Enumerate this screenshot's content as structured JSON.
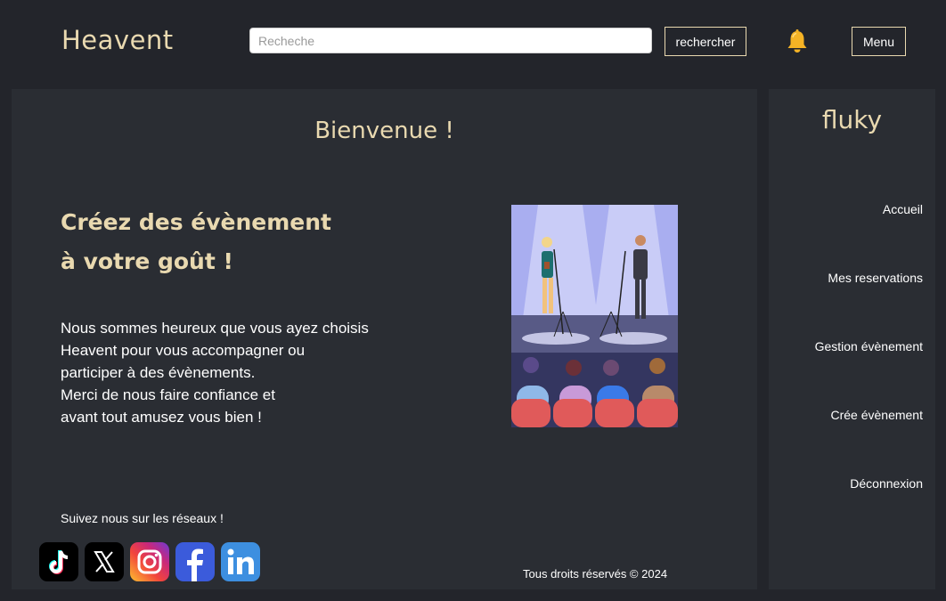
{
  "header": {
    "logo": "Heavent",
    "search": {
      "placeholder": "Recheche",
      "value": ""
    },
    "search_button": "rechercher",
    "menu_button": "Menu"
  },
  "main": {
    "welcome": "Bienvenue !",
    "headline": [
      "Créez des évènement",
      "à votre goût !"
    ],
    "intro": [
      "Nous sommes heureux que vous ayez choisis",
      "Heavent pour vous accompagner ou",
      "participer à des évènements.",
      "Merci de nous faire confiance et",
      "avant tout amusez vous bien !"
    ],
    "follow": "Suivez nous sur les réseaux !",
    "socials": [
      "tiktok-icon",
      "x-icon",
      "instagram-icon",
      "facebook-icon",
      "linkedin-icon"
    ],
    "copyright": "Tous droits réservés © 2024"
  },
  "sidebar": {
    "username": "fluky",
    "items": [
      {
        "label": "Accueil"
      },
      {
        "label": "Mes reservations"
      },
      {
        "label": "Gestion évènement"
      },
      {
        "label": "Crée évènement"
      },
      {
        "label": "Déconnexion"
      }
    ]
  },
  "colors": {
    "background": "#23252b",
    "panel": "#2a2d33",
    "accent": "#e9d9b0"
  }
}
